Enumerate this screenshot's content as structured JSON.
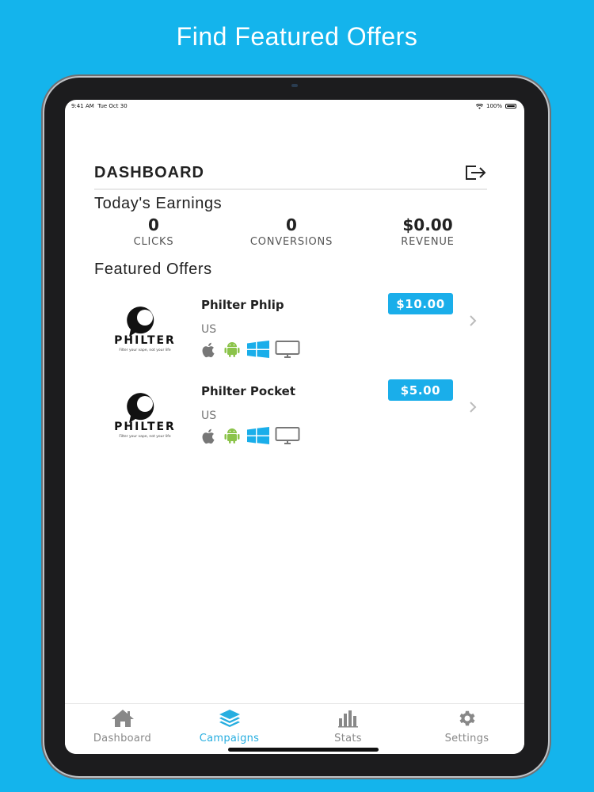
{
  "headline": "Find Featured Offers",
  "status": {
    "time": "9:41 AM",
    "date": "Tue Oct 30",
    "battery": "100%"
  },
  "dashboard": {
    "title": "DASHBOARD"
  },
  "earnings": {
    "title": "Today's Earnings",
    "stats": [
      {
        "value": "0",
        "label": "CLICKS"
      },
      {
        "value": "0",
        "label": "CONVERSIONS"
      },
      {
        "value": "$0.00",
        "label": "REVENUE"
      }
    ]
  },
  "featured": {
    "title": "Featured Offers",
    "offers": [
      {
        "name": "Philter Phlip",
        "price": "$10.00",
        "country": "US",
        "logo_text": "PHILTER",
        "logo_tagline": "Filter your vape, not your life"
      },
      {
        "name": "Philter Pocket",
        "price": "$5.00",
        "country": "US",
        "logo_text": "PHILTER",
        "logo_tagline": "Filter your vape, not your life"
      }
    ]
  },
  "tabs": [
    {
      "label": "Dashboard",
      "icon": "home-icon"
    },
    {
      "label": "Campaigns",
      "icon": "layers-icon"
    },
    {
      "label": "Stats",
      "icon": "bar-chart-icon"
    },
    {
      "label": "Settings",
      "icon": "gear-icon"
    }
  ],
  "colors": {
    "background": "#14b4ec",
    "accent": "#1aaeea",
    "android": "#8bc34a",
    "windows": "#1aaeea"
  }
}
